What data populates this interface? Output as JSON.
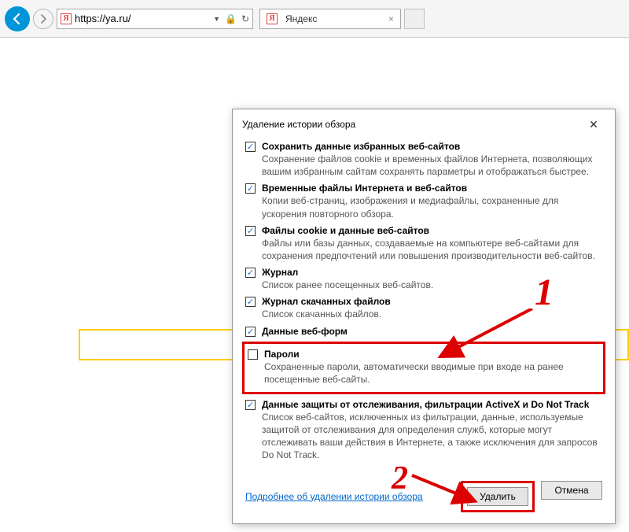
{
  "browser": {
    "url": "https://ya.ru/",
    "tab_title": "Яндекс",
    "favicon_letter": "Я"
  },
  "yandex_search_placeholder": "",
  "dialog": {
    "title": "Удаление истории обзора",
    "options": [
      {
        "checked": true,
        "title": "Сохранить данные избранных веб-сайтов",
        "desc": "Сохранение файлов cookie и временных файлов Интернета, позволяющих вашим избранным сайтам сохранять параметры и отображаться быстрее."
      },
      {
        "checked": true,
        "title": "Временные файлы Интернета и веб-сайтов",
        "desc": "Копии веб-страниц, изображения и медиафайлы, сохраненные для ускорения повторного обзора."
      },
      {
        "checked": true,
        "title": "Файлы cookie и данные веб-сайтов",
        "desc": "Файлы или базы данных, создаваемые на компьютере веб-сайтами для сохранения предпочтений или повышения производительности веб-сайтов."
      },
      {
        "checked": true,
        "title": "Журнал",
        "desc": "Список ранее посещенных веб-сайтов."
      },
      {
        "checked": true,
        "title": "Журнал скачанных файлов",
        "desc": "Список скачанных файлов."
      },
      {
        "checked": true,
        "title": "Данные веб-форм",
        "desc": ""
      },
      {
        "checked": false,
        "title": "Пароли",
        "desc": "Сохраненные пароли, автоматически вводимые при входе на ранее посещенные веб-сайты."
      },
      {
        "checked": true,
        "title": "Данные защиты от отслеживания, фильтрации ActiveX и Do Not Track",
        "desc": "Список веб-сайтов, исключенных из фильтрации, данные, используемые защитой от отслеживания для определения служб, которые могут отслеживать ваши действия в Интернете, а также исключения для запросов Do Not Track."
      }
    ],
    "more_link": "Подробнее об удалении истории обзора",
    "delete_btn": "Удалить",
    "cancel_btn": "Отмена"
  },
  "annotations": {
    "num1": "1",
    "num2": "2"
  }
}
